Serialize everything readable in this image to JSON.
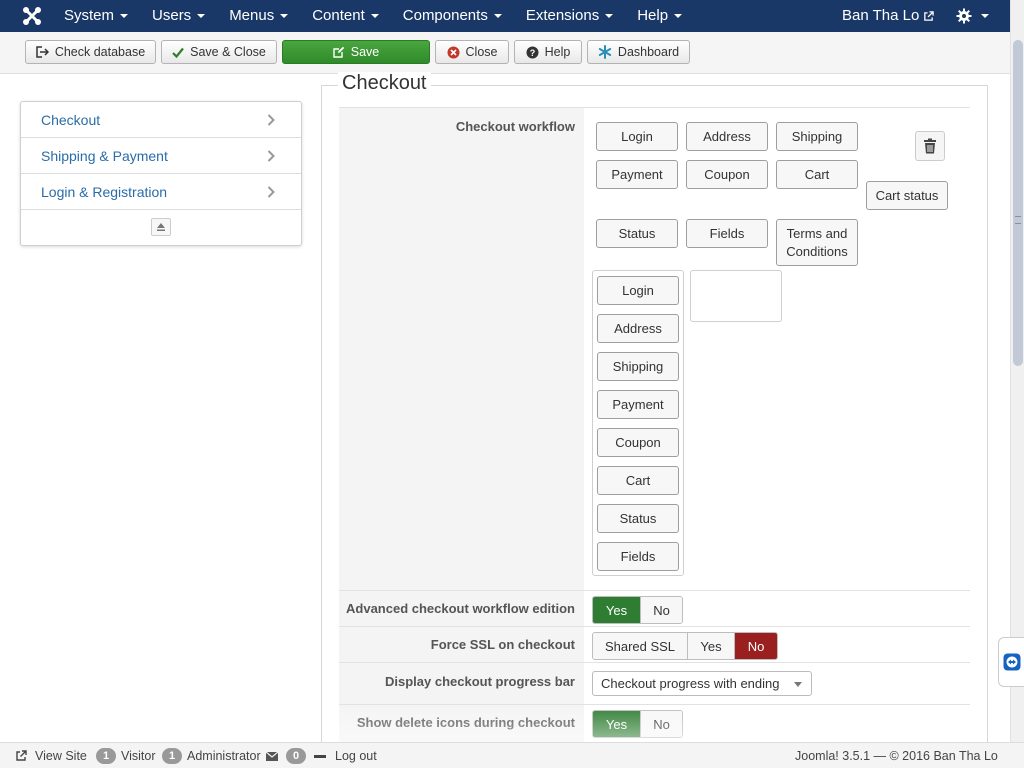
{
  "navbar": {
    "menu": [
      "System",
      "Users",
      "Menus",
      "Content",
      "Components",
      "Extensions",
      "Help"
    ],
    "user_name": "Ban Tha Lo",
    "icons": [
      "joomla-logo-icon",
      "external-link-icon",
      "gear-icon"
    ]
  },
  "toolbar": {
    "check_database": "Check database",
    "save_close": "Save & Close",
    "save": "Save",
    "close": "Close",
    "help": "Help",
    "dashboard": "Dashboard"
  },
  "sidebar": {
    "items": [
      "Checkout",
      "Shipping & Payment",
      "Login & Registration"
    ]
  },
  "main": {
    "legend": "Checkout",
    "workflow": {
      "label": "Checkout workflow",
      "available": {
        "row1": [
          "Login",
          "Address",
          "Shipping"
        ],
        "row2": [
          "Payment",
          "Coupon",
          "Cart"
        ],
        "cart_status": "Cart status",
        "row3": [
          "Status",
          "Fields"
        ],
        "terms_line1": "Terms and",
        "terms_line2": "Conditions"
      },
      "selected": [
        "Login",
        "Address",
        "Shipping",
        "Payment",
        "Coupon",
        "Cart",
        "Status",
        "Fields"
      ]
    },
    "advanced": {
      "label": "Advanced checkout workflow edition",
      "yes": "Yes",
      "no": "No",
      "value": "Yes"
    },
    "force_ssl": {
      "label": "Force SSL on checkout",
      "opt1": "Shared SSL",
      "opt2": "Yes",
      "opt3": "No",
      "value": "No"
    },
    "progress": {
      "label": "Display checkout progress bar",
      "value": "Checkout progress with ending"
    },
    "delete_icons": {
      "label": "Show delete icons during checkout",
      "yes": "Yes",
      "no": "No",
      "value": "Yes"
    }
  },
  "statusbar": {
    "view_site": "View Site",
    "visitor_count": "1",
    "visitor_label": "Visitor",
    "admin_count": "1",
    "admin_label": "Administrator",
    "messages_count": "0",
    "logout": "Log out",
    "version": "Joomla! 3.5.1 — © 2016 Ban Tha Lo"
  },
  "colors": {
    "navbar": "#1a3867",
    "save_green": "#2f8a2a",
    "toggle_yes": "#2e7d32",
    "toggle_no": "#9a1f1f",
    "link_blue": "#2a6ca8"
  }
}
